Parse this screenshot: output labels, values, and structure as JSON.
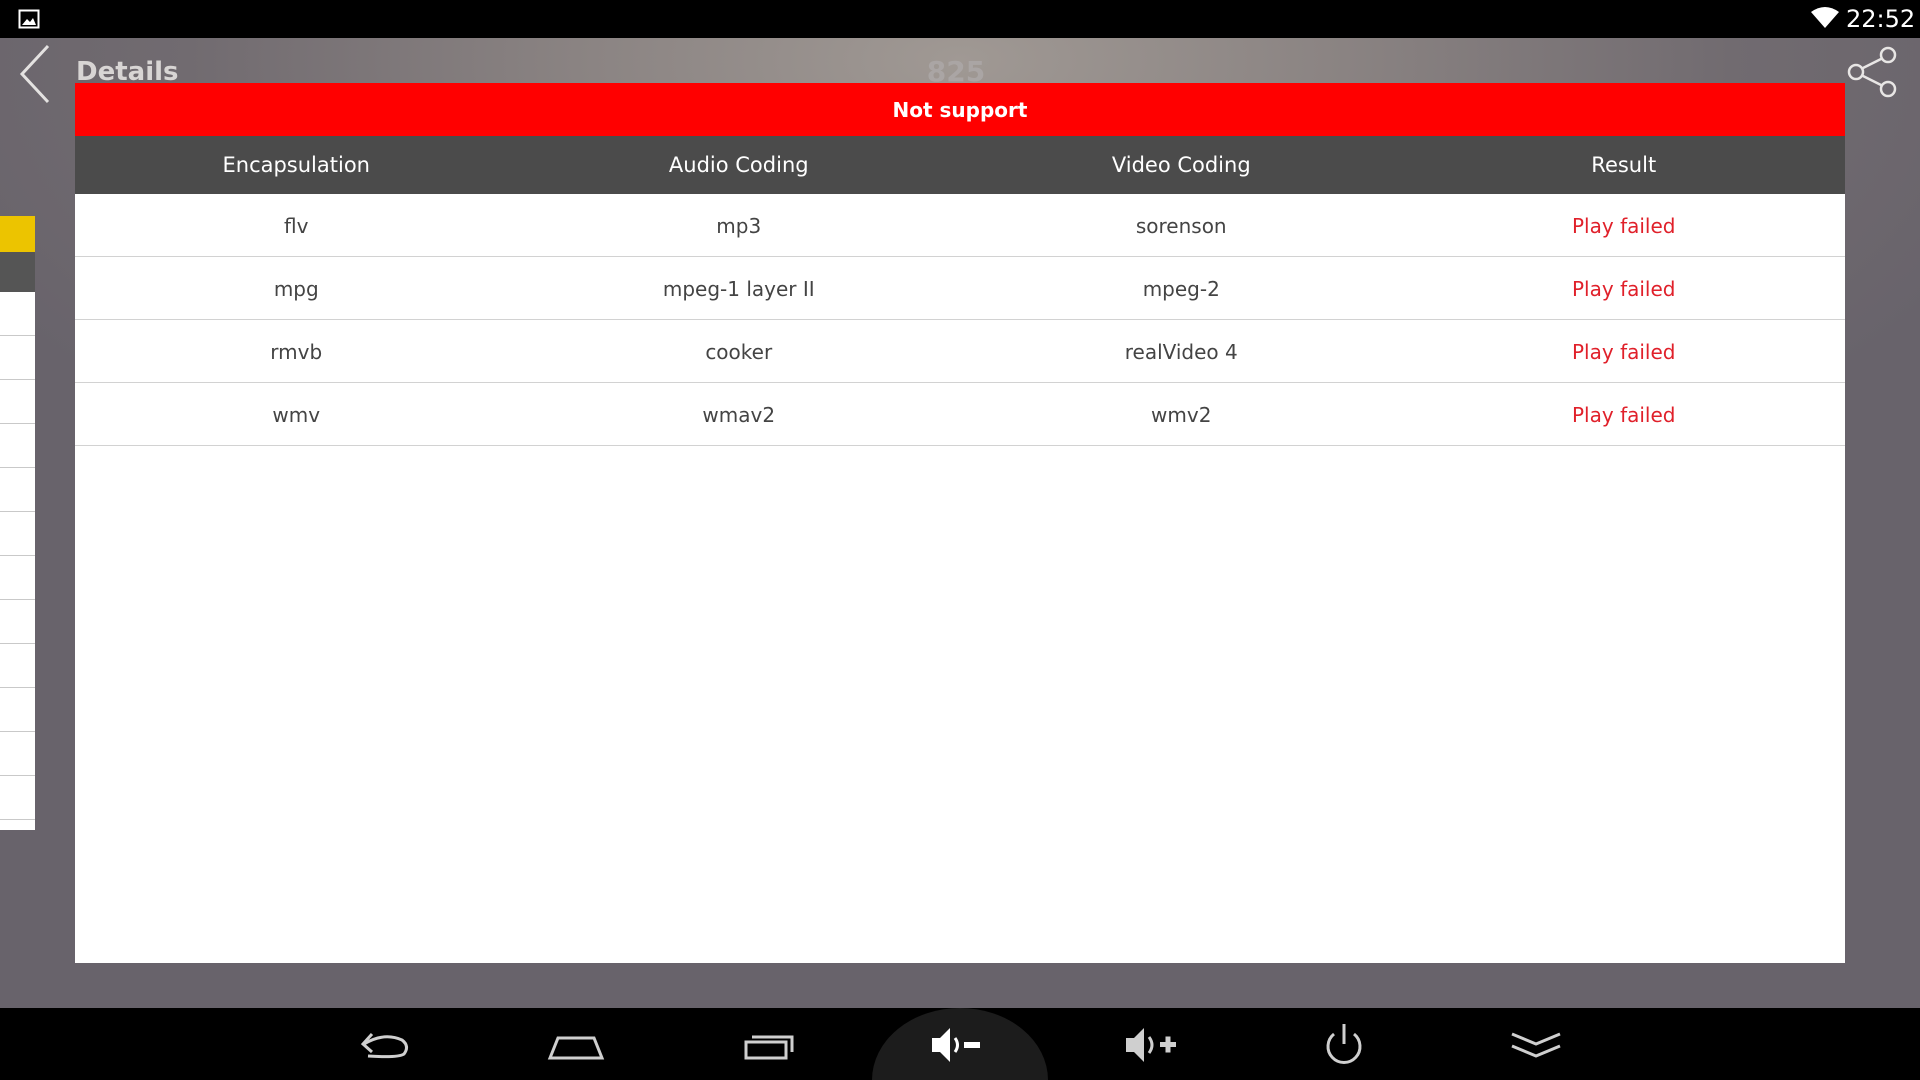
{
  "status_bar": {
    "time": "22:52",
    "icons": [
      "gallery-icon",
      "wifi-icon"
    ]
  },
  "app_bar": {
    "title": "Details",
    "center_title": "825",
    "icons": [
      "back-icon",
      "share-icon"
    ]
  },
  "dialog": {
    "title": "Not support",
    "accent_color": "#ff0000",
    "columns": [
      "Encapsulation",
      "Audio Coding",
      "Video Coding",
      "Result"
    ],
    "rows": [
      {
        "encapsulation": "flv",
        "audio": "mp3",
        "video": "sorenson",
        "result": "Play failed"
      },
      {
        "encapsulation": "mpg",
        "audio": "mpeg-1 layer II",
        "video": "mpeg-2",
        "result": "Play failed"
      },
      {
        "encapsulation": "rmvb",
        "audio": "cooker",
        "video": "realVideo 4",
        "result": "Play failed"
      },
      {
        "encapsulation": "wmv",
        "audio": "wmav2",
        "video": "wmv2",
        "result": "Play failed"
      }
    ],
    "result_color": "#e0202a"
  },
  "nav_bar": {
    "buttons": [
      "nav-back-icon",
      "home-icon",
      "recent-apps-icon",
      "volume-down-icon",
      "volume-up-icon",
      "power-icon",
      "hide-bar-icon"
    ]
  }
}
